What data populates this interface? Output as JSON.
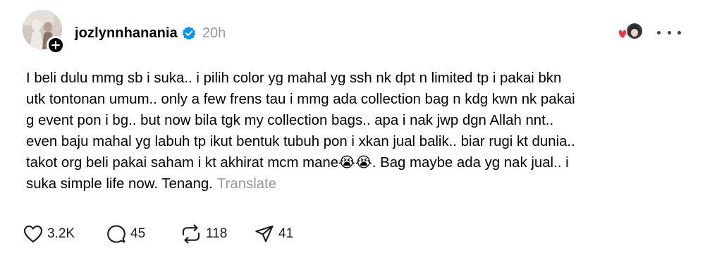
{
  "post": {
    "author": {
      "username": "jozlynnhanania",
      "verified": true,
      "avatar_icon": "avatar-photo",
      "follow_icon": "plus-icon"
    },
    "timestamp": "20h",
    "reaction_icon": "heart-avatar-icon",
    "more_icon": "more-horizontal-icon",
    "body_lines": [
      "I beli dulu mmg sb i suka.. i pilih color yg mahal yg ssh nk dpt n limited tp i pakai bkn",
      "utk tontonan umum.. only a few frens tau i mmg ada collection bag n kdg kwn nk pakai",
      "g event pon i bg.. but now bila tgk my collection bags.. apa i nak jwp dgn Allah nnt..",
      "even baju mahal yg labuh tp ikut bentuk tubuh pon i xkan jual balik.. biar rugi kt dunia..",
      "takot org beli pakai saham i kt akhirat mcm mane😭😭. Bag maybe ada yg nak jual.. i",
      "suka simple life now. Tenang."
    ],
    "translate_label": "Translate",
    "actions": {
      "likes": "3.2K",
      "replies": "45",
      "reposts": "118",
      "shares": "41"
    },
    "colors": {
      "text": "#000000",
      "muted": "#999999",
      "verified": "#0095f6",
      "heart": "#ff3040"
    }
  }
}
